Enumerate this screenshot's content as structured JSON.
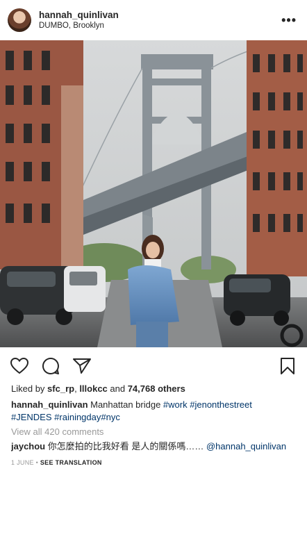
{
  "post": {
    "username": "hannah_quinlivan",
    "location": "DUMBO, Brooklyn",
    "more_label": "•••"
  },
  "icons": {
    "avatar": "profile-avatar",
    "like": "heart-icon",
    "comment": "comment-icon",
    "share": "paper-plane-icon",
    "save": "bookmark-icon",
    "more": "more-options-icon"
  },
  "likes": {
    "prefix": "Liked by ",
    "user1": "sfc_rp",
    "sep": ", ",
    "user2": "lllokcc",
    "and": " and ",
    "others": "74,768 others"
  },
  "caption": {
    "user": "hannah_quinlivan",
    "text": " Manhattan bridge ",
    "tags": [
      "#work",
      "#jenonthestreet",
      "#JENDES",
      "#rainingday",
      "#nyc"
    ]
  },
  "view_all": "View all 420 comments",
  "comment": {
    "user": "jaychou",
    "text": " 你怎麼拍的比我好看 是人的關係嗎…… ",
    "mention": "@hannah_quinlivan"
  },
  "footer": {
    "date": "1 JUNE",
    "dot": " • ",
    "translate": "SEE TRANSLATION"
  },
  "colors": {
    "text": "#262626",
    "link": "#003569",
    "muted": "#999999"
  }
}
